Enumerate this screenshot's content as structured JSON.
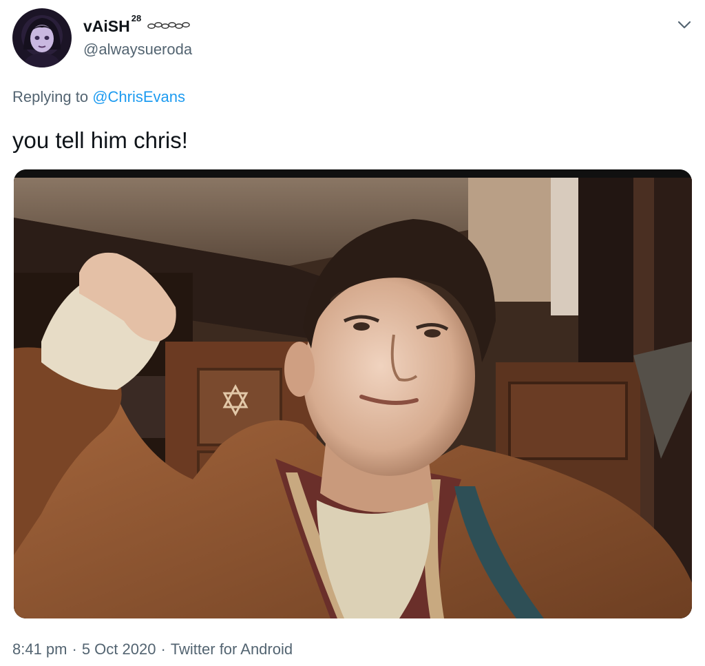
{
  "author": {
    "display_name": "vAiSH",
    "display_name_sup": "28",
    "handle": "@alwaysueroda"
  },
  "reply": {
    "prefix": "Replying to",
    "mention": "@ChrisEvans"
  },
  "tweet": {
    "text": "you tell him chris!"
  },
  "meta": {
    "time": "8:41 pm",
    "separator": "·",
    "date": "5 Oct 2020",
    "source": "Twitter for Android"
  },
  "colors": {
    "text": "#0f1419",
    "secondary": "#536471",
    "link": "#1d9bf0"
  },
  "icons": {
    "caret": "chevron-down-icon",
    "decoration": "chain-decoration-icon"
  }
}
